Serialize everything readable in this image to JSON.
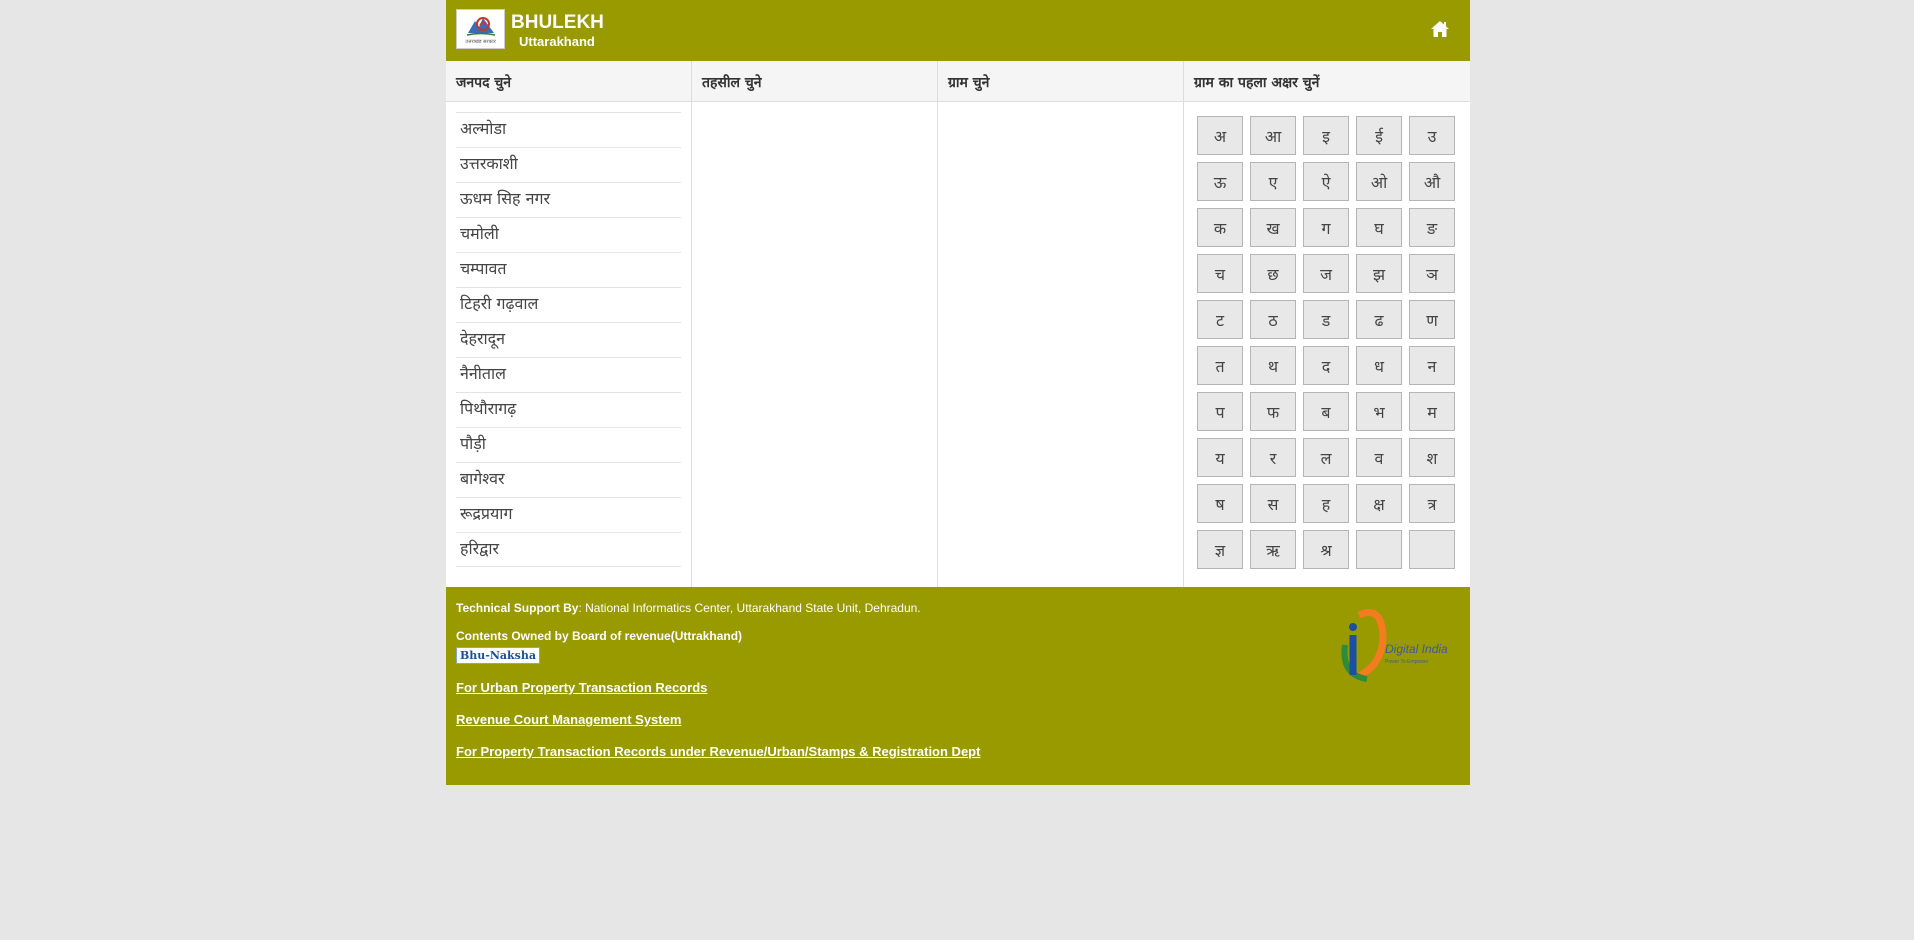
{
  "header": {
    "title": "BHULEKH",
    "subtitle": "Uttarakhand",
    "logo_caption": "उत्तराखंड सरकार"
  },
  "columns": {
    "district_header": "जनपद चुने",
    "tehsil_header": "तहसील चुने",
    "village_header": "ग्राम चुने",
    "letter_header": "ग्राम का पहला अक्षर चुनें"
  },
  "districts": [
    "अल्मोडा",
    "उत्तरकाशी",
    "ऊधम सिह नगर",
    "चमोली",
    "चम्पावत",
    "टिहरी गढ़वाल",
    "देहरादून",
    "नैनीताल",
    "पिथौरागढ़",
    "पौड़ी",
    "बागेश्वर",
    "रूद्रप्रयाग",
    "हरिद्वार"
  ],
  "letters": [
    "अ",
    "आ",
    "इ",
    "ई",
    "उ",
    "ऊ",
    "ए",
    "ऐ",
    "ओ",
    "औ",
    "क",
    "ख",
    "ग",
    "घ",
    "ङ",
    "च",
    "छ",
    "ज",
    "झ",
    "ञ",
    "ट",
    "ठ",
    "ड",
    "ढ",
    "ण",
    "त",
    "थ",
    "द",
    "ध",
    "न",
    "प",
    "फ",
    "ब",
    "भ",
    "म",
    "य",
    "र",
    "ल",
    "व",
    "श",
    "ष",
    "स",
    "ह",
    "क्ष",
    "त्र",
    "ज्ञ",
    "ऋ",
    "श्र",
    "",
    ""
  ],
  "footer": {
    "support_label": "Technical Support By",
    "support_text": ": National Informatics Center, Uttarakhand State Unit, Dehradun.",
    "owned_text": "Contents Owned by Board of revenue(Uttrakhand)",
    "bhunaksha_label": "Bhu-Naksha",
    "link_urban": "For Urban Property Transaction Records",
    "link_court": "Revenue Court Management System",
    "link_property": "For Property Transaction Records under Revenue/Urban/Stamps & Registration Dept",
    "digital_india_title": "Digital India",
    "digital_india_tagline": "Power To Empower"
  },
  "colors": {
    "header_bg": "#999900",
    "footer_bg": "#999900",
    "page_bg": "#e6e6e6"
  }
}
